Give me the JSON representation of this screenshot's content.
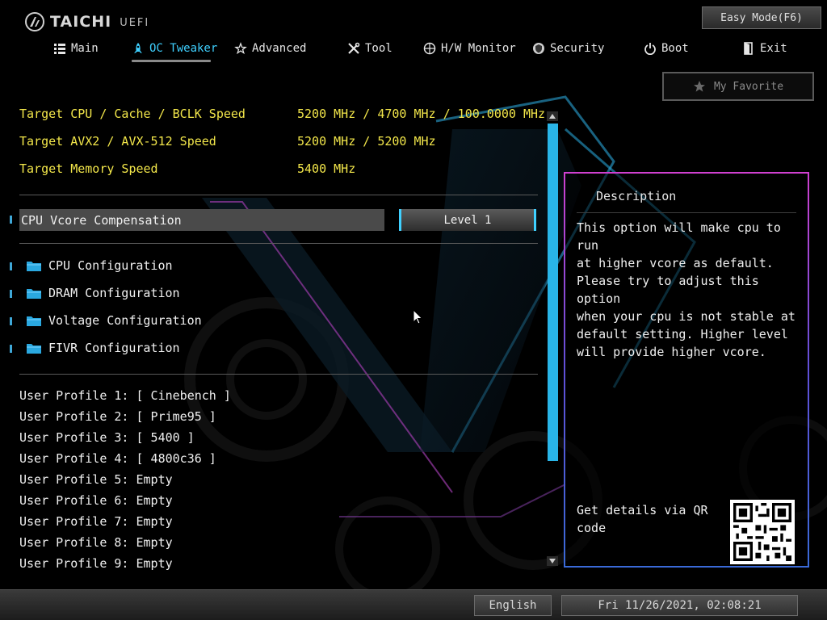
{
  "header": {
    "brand": "TAICHI",
    "brand_suffix": "UEFI",
    "easy_mode_label": "Easy Mode(F6)",
    "favorite_label": "My Favorite"
  },
  "nav": {
    "items": [
      {
        "label": "Main",
        "icon": "list-icon"
      },
      {
        "label": "OC Tweaker",
        "icon": "rocket-icon",
        "active": true
      },
      {
        "label": "Advanced",
        "icon": "star-icon"
      },
      {
        "label": "Tool",
        "icon": "tools-icon"
      },
      {
        "label": "H/W Monitor",
        "icon": "monitor-icon"
      },
      {
        "label": "Security",
        "icon": "shield-icon"
      },
      {
        "label": "Boot",
        "icon": "power-icon"
      },
      {
        "label": "Exit",
        "icon": "exit-icon"
      }
    ]
  },
  "targets": [
    {
      "label": "Target CPU / Cache / BCLK Speed",
      "value": "5200 MHz / 4700 MHz / 100.0000 MHz"
    },
    {
      "label": "Target AVX2 / AVX-512 Speed",
      "value": "5200 MHz / 5200 MHz"
    },
    {
      "label": "Target Memory Speed",
      "value": "5400 MHz"
    }
  ],
  "vcore": {
    "label": "CPU Vcore Compensation",
    "value": "Level 1"
  },
  "submenus": [
    {
      "label": "CPU Configuration"
    },
    {
      "label": "DRAM Configuration"
    },
    {
      "label": "Voltage Configuration"
    },
    {
      "label": "FIVR Configuration"
    }
  ],
  "profiles": [
    "User Profile 1: [ Cinebench ]",
    "User Profile 2: [ Prime95 ]",
    "User Profile 3: [ 5400 ]",
    "User Profile 4: [ 4800c36 ]",
    "User Profile 5: Empty",
    "User Profile 6: Empty",
    "User Profile 7: Empty",
    "User Profile 8: Empty",
    "User Profile 9: Empty"
  ],
  "description": {
    "title": "Description",
    "text": "This option will make cpu to run\nat higher vcore as default.\nPlease try to adjust this option\nwhen your cpu is not stable at\ndefault setting. Higher level\nwill provide higher vcore.",
    "qr_label": "Get details via QR\ncode"
  },
  "footer": {
    "language": "English",
    "datetime": "Fri 11/26/2021, 02:08:21"
  },
  "colors": {
    "accent": "#3fd0ff",
    "info_text": "#f2e64a",
    "highlight_row": "#4a4a4a",
    "scrollbar": "#29b5e8"
  }
}
